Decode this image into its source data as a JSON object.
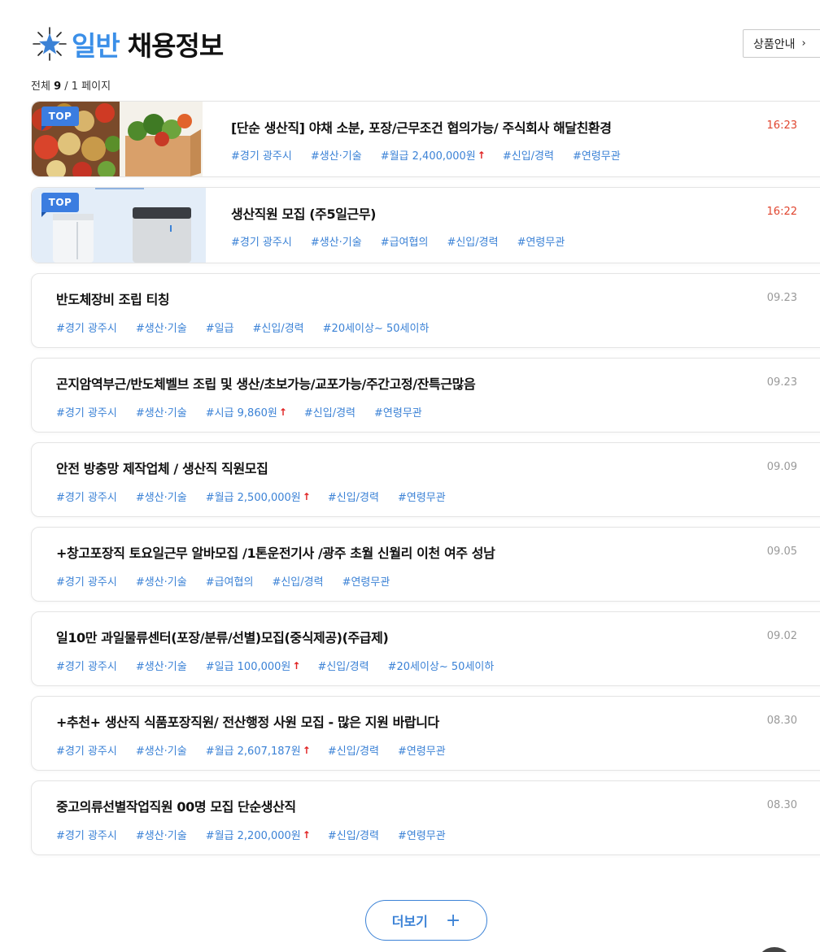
{
  "header": {
    "title_accent": "일반",
    "title_main": "채용정보",
    "product_guide_label": "상품안내",
    "chevron": "›"
  },
  "summary": {
    "prefix": "전체 ",
    "total": "9",
    "sep": " / ",
    "pages": "1",
    "suffix": " 페이지"
  },
  "jobs": [
    {
      "title": "[단순 생산직] 야채 소분, 포장/근무조건 협의가능/ 주식회사 해달친환경",
      "time": "16:23",
      "badge": "TOP",
      "thumb": "vegetables-image",
      "tags": [
        {
          "text": "#경기 광주시",
          "up": ""
        },
        {
          "text": "#생산·기술",
          "up": ""
        },
        {
          "text": "#월급 2,400,000원",
          "up": "↑"
        },
        {
          "text": "#신입/경력",
          "up": ""
        },
        {
          "text": "#연령무관",
          "up": ""
        }
      ]
    },
    {
      "title": "생산직원 모집 (주5일근무)",
      "time": "16:22",
      "badge": "TOP",
      "thumb": "air-purifier-image",
      "tags": [
        {
          "text": "#경기 광주시",
          "up": ""
        },
        {
          "text": "#생산·기술",
          "up": ""
        },
        {
          "text": "#급여협의",
          "up": ""
        },
        {
          "text": "#신입/경력",
          "up": ""
        },
        {
          "text": "#연령무관",
          "up": ""
        }
      ]
    },
    {
      "title": "반도체장비 조립 티칭",
      "time": "09.23",
      "tags": [
        {
          "text": "#경기 광주시",
          "up": ""
        },
        {
          "text": "#생산·기술",
          "up": ""
        },
        {
          "text": "#일급",
          "up": ""
        },
        {
          "text": "#신입/경력",
          "up": ""
        },
        {
          "text": "#20세이상~ 50세이하",
          "up": ""
        }
      ]
    },
    {
      "title": "곤지암역부근/반도체벨브 조립 및 생산/초보가능/교포가능/주간고정/잔특근많음",
      "time": "09.23",
      "tags": [
        {
          "text": "#경기 광주시",
          "up": ""
        },
        {
          "text": "#생산·기술",
          "up": ""
        },
        {
          "text": "#시급 9,860원",
          "up": "↑"
        },
        {
          "text": "#신입/경력",
          "up": ""
        },
        {
          "text": "#연령무관",
          "up": ""
        }
      ]
    },
    {
      "title": "안전 방충망 제작업체 / 생산직 직원모집",
      "time": "09.09",
      "tags": [
        {
          "text": "#경기 광주시",
          "up": ""
        },
        {
          "text": "#생산·기술",
          "up": ""
        },
        {
          "text": "#월급 2,500,000원",
          "up": "↑"
        },
        {
          "text": "#신입/경력",
          "up": ""
        },
        {
          "text": "#연령무관",
          "up": ""
        }
      ]
    },
    {
      "title": "+창고포장직 토요일근무 알바모집 /1톤운전기사 /광주 초월 신월리 이천 여주 성남",
      "time": "09.05",
      "tags": [
        {
          "text": "#경기 광주시",
          "up": ""
        },
        {
          "text": "#생산·기술",
          "up": ""
        },
        {
          "text": "#급여협의",
          "up": ""
        },
        {
          "text": "#신입/경력",
          "up": ""
        },
        {
          "text": "#연령무관",
          "up": ""
        }
      ]
    },
    {
      "title": "일10만 과일물류센터(포장/분류/선별)모집(중식제공)(주급제)",
      "time": "09.02",
      "tags": [
        {
          "text": "#경기 광주시",
          "up": ""
        },
        {
          "text": "#생산·기술",
          "up": ""
        },
        {
          "text": "#일급 100,000원",
          "up": "↑"
        },
        {
          "text": "#신입/경력",
          "up": ""
        },
        {
          "text": "#20세이상~ 50세이하",
          "up": ""
        }
      ]
    },
    {
      "title": "+추천+ 생산직 식품포장직원/ 전산행정 사원 모집 - 많은 지원 바랍니다",
      "time": "08.30",
      "tags": [
        {
          "text": "#경기 광주시",
          "up": ""
        },
        {
          "text": "#생산·기술",
          "up": ""
        },
        {
          "text": "#월급 2,607,187원",
          "up": "↑"
        },
        {
          "text": "#신입/경력",
          "up": ""
        },
        {
          "text": "#연령무관",
          "up": ""
        }
      ]
    },
    {
      "title": "중고의류선별작업직원 00명 모집 단순생산직",
      "time": "08.30",
      "tags": [
        {
          "text": "#경기 광주시",
          "up": ""
        },
        {
          "text": "#생산·기술",
          "up": ""
        },
        {
          "text": "#월급 2,200,000원",
          "up": "↑"
        },
        {
          "text": "#신입/경력",
          "up": ""
        },
        {
          "text": "#연령무관",
          "up": ""
        }
      ]
    }
  ],
  "more_button": {
    "label": "더보기",
    "plus": "+"
  },
  "colors": {
    "accent": "#3b82d6",
    "new_time": "#e0452f",
    "salary_up": "#e02020"
  }
}
